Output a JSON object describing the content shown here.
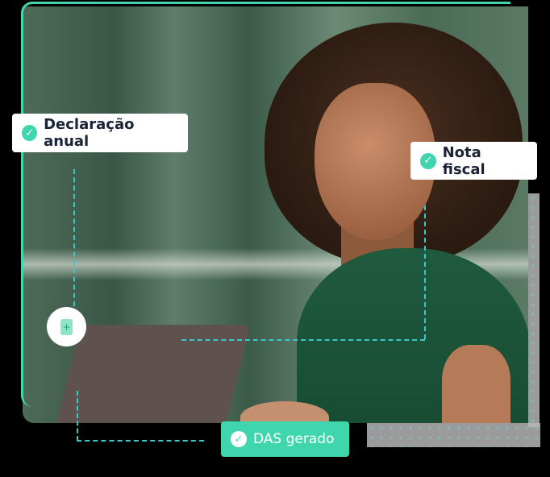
{
  "cards": {
    "annual_declaration": "Declaração anual",
    "invoice": "Nota fiscal",
    "das_generated": "DAS gerado"
  },
  "icons": {
    "check": "✓",
    "document_add": "+"
  },
  "colors": {
    "accent": "#3fd6ad",
    "dashed_line": "#3cc8c8",
    "text": "#1b2337"
  }
}
